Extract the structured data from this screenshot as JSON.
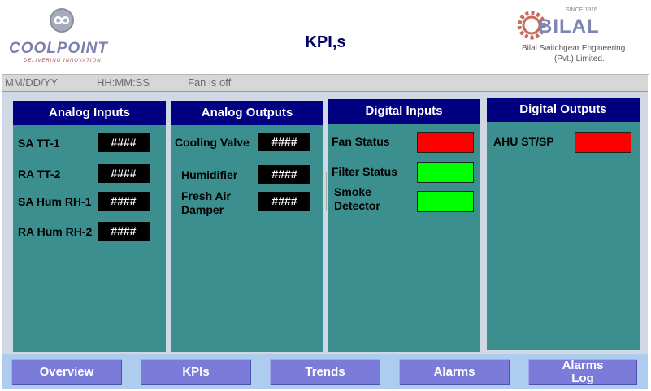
{
  "header": {
    "title": "KPI,s",
    "left_logo": {
      "brand": "COOLPOINT",
      "tagline": "DELIVERING INNOVATION",
      "icon": "infinity-icon"
    },
    "right_logo": {
      "brand": "BILAL",
      "since": "SINCE 1976",
      "company_line1": "Bilal Switchgear Engineering",
      "company_line2": "(Pvt.) Limited.",
      "icon": "gear-icon"
    }
  },
  "status": {
    "date": "MM/DD/YY",
    "time": "HH:MM:SS",
    "fan": "Fan is off"
  },
  "panels": {
    "analog_inputs": {
      "title": "Analog Inputs",
      "items": [
        {
          "label": "SA TT-1",
          "value": "####"
        },
        {
          "label": "RA TT-2",
          "value": "####"
        },
        {
          "label": "SA Hum RH-1",
          "value": "####"
        },
        {
          "label": "RA Hum RH-2",
          "value": "####"
        }
      ]
    },
    "analog_outputs": {
      "title": "Analog Outputs",
      "items": [
        {
          "label": "Cooling Valve",
          "value": "####"
        },
        {
          "label": "Humidifier",
          "value": "####"
        },
        {
          "label": "Fresh Air Damper",
          "value": "####"
        }
      ]
    },
    "digital_inputs": {
      "title": "Digital Inputs",
      "items": [
        {
          "label": "Fan Status",
          "color": "#ff0000"
        },
        {
          "label": "Filter Status",
          "color": "#00ff00"
        },
        {
          "label": "Smoke Detector",
          "color": "#00ff00"
        }
      ]
    },
    "digital_outputs": {
      "title": "Digital Outputs",
      "items": [
        {
          "label": "AHU ST/SP",
          "color": "#ff0000"
        }
      ]
    }
  },
  "nav": [
    {
      "label": "Overview"
    },
    {
      "label": "KPIs"
    },
    {
      "label": "Trends"
    },
    {
      "label": "Alarms"
    },
    {
      "label": "Alarms Log"
    }
  ],
  "colors": {
    "panel_bg": "#3b8f8f",
    "panel_header": "#000080",
    "nav_button": "#7b7bd9",
    "status_red": "#ff0000",
    "status_green": "#00ff00"
  }
}
